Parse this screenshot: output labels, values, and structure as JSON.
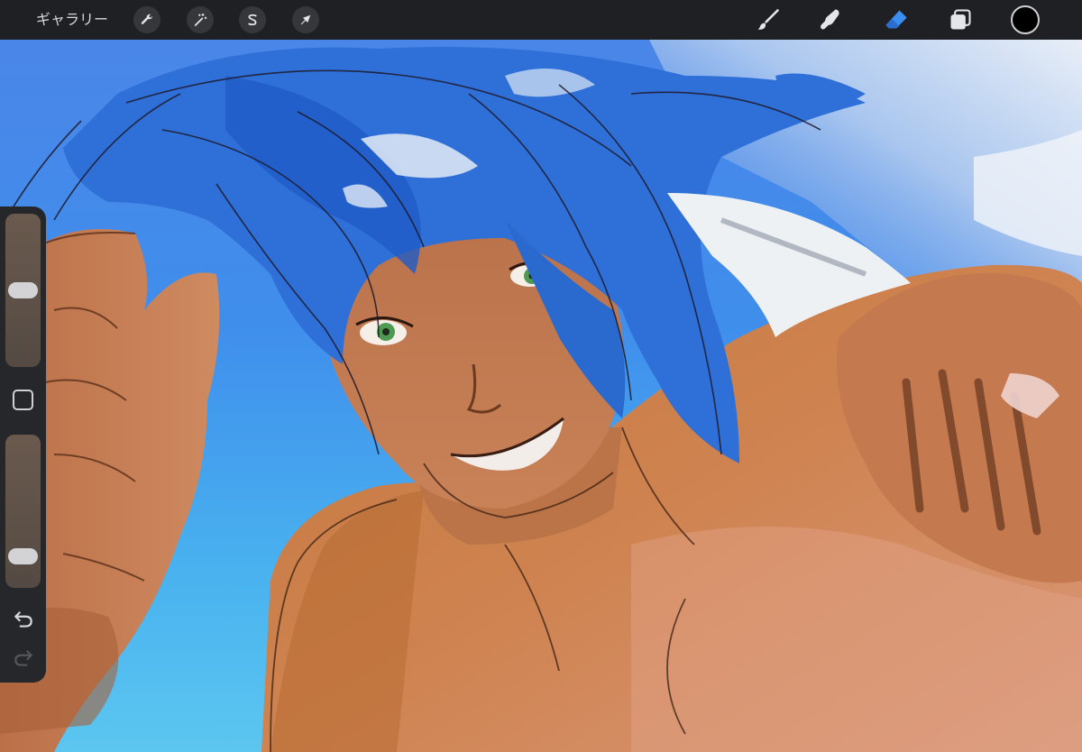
{
  "topbar": {
    "gallery_label": "ギャラリー",
    "left_tools": [
      {
        "name": "actions",
        "icon": "wrench-icon"
      },
      {
        "name": "adjustments",
        "icon": "magic-wand-icon"
      },
      {
        "name": "selection",
        "icon": "selection-s-icon"
      },
      {
        "name": "transform",
        "icon": "arrow-cursor-icon"
      }
    ],
    "right_tools": [
      {
        "name": "brush",
        "icon": "brush-icon",
        "active": false
      },
      {
        "name": "smudge",
        "icon": "smudge-finger-icon",
        "active": false
      },
      {
        "name": "eraser",
        "icon": "eraser-icon",
        "active": true
      },
      {
        "name": "layers",
        "icon": "layers-icon",
        "active": false
      }
    ],
    "current_color": "#000000",
    "active_tool_color": "#3a8ff0",
    "icon_color": "#e6e6e8"
  },
  "sidebar": {
    "brush_size_level": 0.5,
    "opacity_level": 0.15,
    "modify_button_icon": "square-icon",
    "undo_icon": "undo-arrow-icon",
    "redo_icon": "redo-arrow-icon"
  },
  "canvas": {
    "sky_color": "#4285e6",
    "hair_color": "#2f6fd8",
    "skin_color": "#c07a45"
  }
}
